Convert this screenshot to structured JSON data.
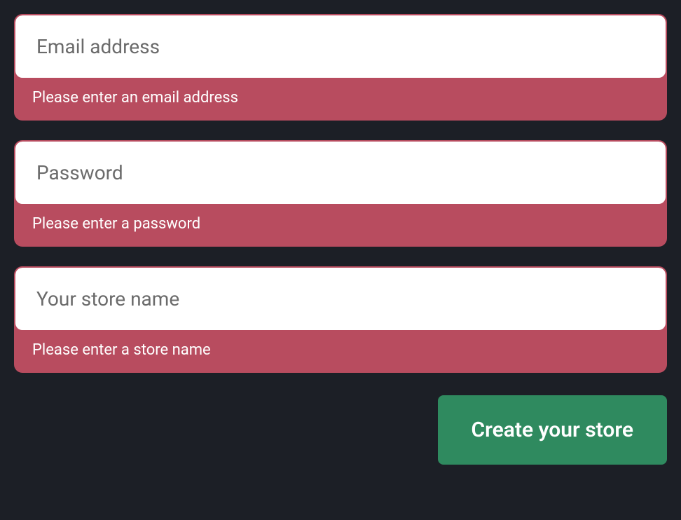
{
  "form": {
    "fields": {
      "email": {
        "placeholder": "Email address",
        "value": "",
        "error": "Please enter an email address"
      },
      "password": {
        "placeholder": "Password",
        "value": "",
        "error": "Please enter a password"
      },
      "store_name": {
        "placeholder": "Your store name",
        "value": "",
        "error": "Please enter a store name"
      }
    },
    "submit_label": "Create your store"
  },
  "colors": {
    "background": "#1c1f26",
    "error_bg": "#b84c5f",
    "input_bg": "#ffffff",
    "button_bg": "#2f8a5f",
    "button_text": "#ffffff",
    "error_text": "#ffffff"
  }
}
